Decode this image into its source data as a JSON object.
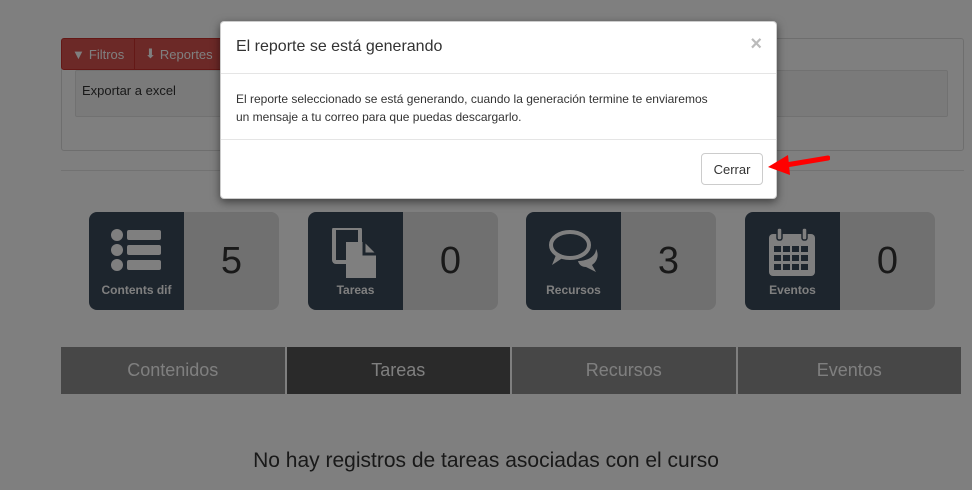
{
  "toolbar": {
    "filters_label": "Filtros",
    "reports_label": "Reportes",
    "export_option": "Exportar a excel"
  },
  "stats": [
    {
      "label": "Contents dif",
      "value": "5",
      "icon": "list-icon"
    },
    {
      "label": "Tareas",
      "value": "0",
      "icon": "documents-icon"
    },
    {
      "label": "Recursos",
      "value": "3",
      "icon": "comments-icon"
    },
    {
      "label": "Eventos",
      "value": "0",
      "icon": "calendar-icon"
    }
  ],
  "tabs": [
    {
      "label": "Contenidos",
      "active": false
    },
    {
      "label": "Tareas",
      "active": true
    },
    {
      "label": "Recursos",
      "active": false
    },
    {
      "label": "Eventos",
      "active": false
    }
  ],
  "empty_message": "No hay registros de tareas asociadas con el curso",
  "modal": {
    "title": "El reporte se está generando",
    "close_glyph": "×",
    "body_line1": "El reporte seleccionado se está generando, cuando la generación termine te enviaremos",
    "body_line2": "un mensaje a tu correo para que puedas descargarlo.",
    "close_button": "Cerrar"
  },
  "colors": {
    "accent_red": "#d9534f",
    "stat_dark": "#3b4a5a",
    "annotation_arrow": "#ff0000"
  }
}
